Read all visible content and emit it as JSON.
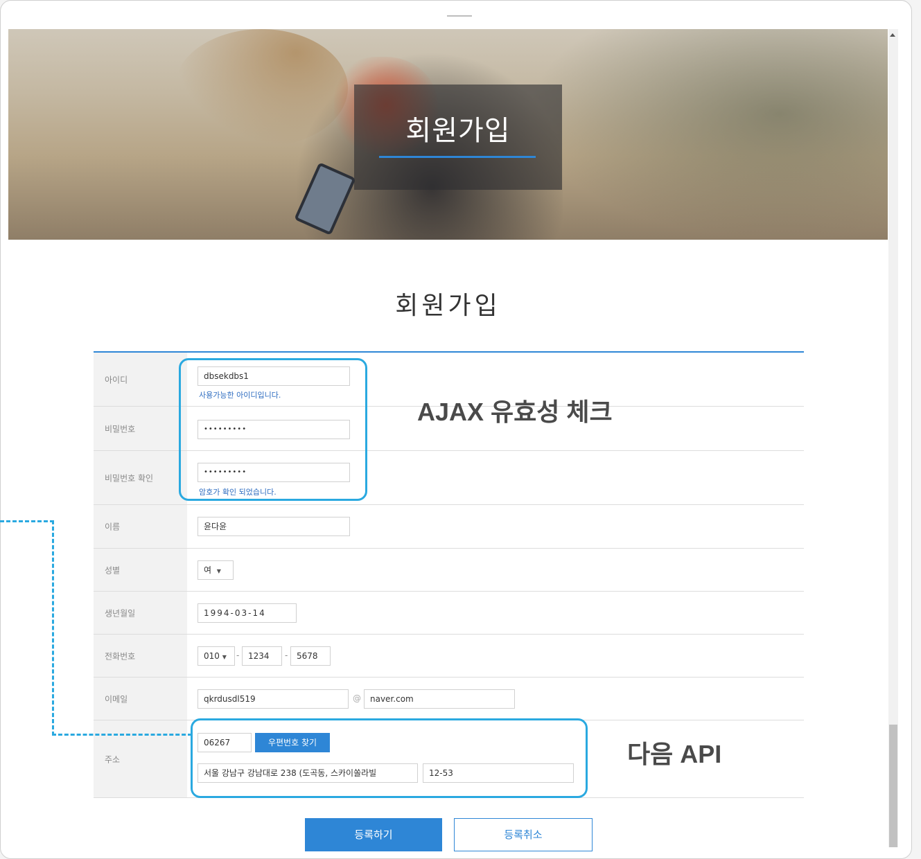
{
  "header": {
    "hero_title": "회원가입"
  },
  "page_title": "회원가입",
  "form": {
    "id": {
      "label": "아이디",
      "value": "dbsekdbs1",
      "hint": "사용가능한 아이디입니다."
    },
    "password": {
      "label": "비밀번호",
      "value": "•••••••••"
    },
    "password_confirm": {
      "label": "비밀번호 확인",
      "value": "•••••••••",
      "hint": "암호가 확인 되었습니다."
    },
    "name": {
      "label": "이름",
      "value": "윤다윤"
    },
    "gender": {
      "label": "성별",
      "value": "여"
    },
    "birth": {
      "label": "생년월일",
      "value": "1994-03-14"
    },
    "phone": {
      "label": "전화번호",
      "prefix": "010",
      "middle": "1234",
      "last": "5678",
      "separator": "-"
    },
    "email": {
      "label": "이메일",
      "local": "qkrdusdl519",
      "at": "@",
      "domain": "naver.com"
    },
    "address": {
      "label": "주소",
      "zip": "06267",
      "zip_button": "우편번호 찾기",
      "addr1": "서울 강남구 강남대로 238 (도곡동, 스카이쏠라빌",
      "addr2": "12-53"
    }
  },
  "buttons": {
    "register": "등록하기",
    "cancel": "등록취소"
  },
  "annotations": {
    "ajax": "AJAX 유효성 체크",
    "api": "다음 API"
  },
  "colors": {
    "accent": "#2e86d6",
    "callout": "#2aa9e0",
    "hint": "#2d6cc0"
  }
}
